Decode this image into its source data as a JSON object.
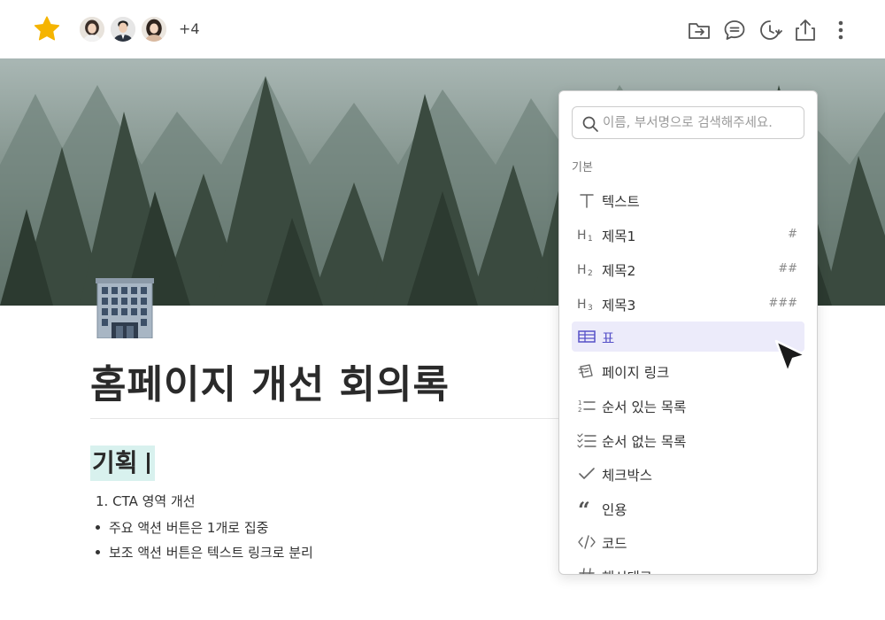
{
  "header": {
    "extra_collaborators": "+4"
  },
  "page": {
    "title": "홈페이지 개선 회의록",
    "heading": "기획",
    "list": [
      {
        "marker": "1.",
        "text": "CTA 영역 개선"
      },
      {
        "marker": "•",
        "text": "주요 액션 버튼은 1개로 집중"
      },
      {
        "marker": "•",
        "text": "보조 액션 버튼은 텍스트 링크로 분리"
      }
    ]
  },
  "menu": {
    "search_placeholder": "이름, 부서명으로 검색해주세요.",
    "section_label": "기본",
    "items": [
      {
        "label": "텍스트",
        "shortcut": "",
        "icon": "text-icon"
      },
      {
        "label": "제목1",
        "shortcut": "#",
        "icon": "heading1-icon"
      },
      {
        "label": "제목2",
        "shortcut": "##",
        "icon": "heading2-icon"
      },
      {
        "label": "제목3",
        "shortcut": "###",
        "icon": "heading3-icon"
      },
      {
        "label": "표",
        "shortcut": "",
        "icon": "table-icon"
      },
      {
        "label": "페이지 링크",
        "shortcut": "",
        "icon": "page-link-icon"
      },
      {
        "label": "순서 있는 목록",
        "shortcut": "",
        "icon": "ordered-list-icon"
      },
      {
        "label": "순서 없는 목록",
        "shortcut": "",
        "icon": "unordered-list-icon"
      },
      {
        "label": "체크박스",
        "shortcut": "",
        "icon": "checkbox-icon"
      },
      {
        "label": "인용",
        "shortcut": "",
        "icon": "quote-icon"
      },
      {
        "label": "코드",
        "shortcut": "",
        "icon": "code-icon"
      },
      {
        "label": "해시태그",
        "shortcut": "",
        "icon": "hashtag-icon"
      }
    ]
  },
  "colors": {
    "accent": "#5651c8",
    "active_item_bg": "#ecebfa",
    "heading_highlight": "#d8f1ee",
    "star": "#f5b400"
  }
}
